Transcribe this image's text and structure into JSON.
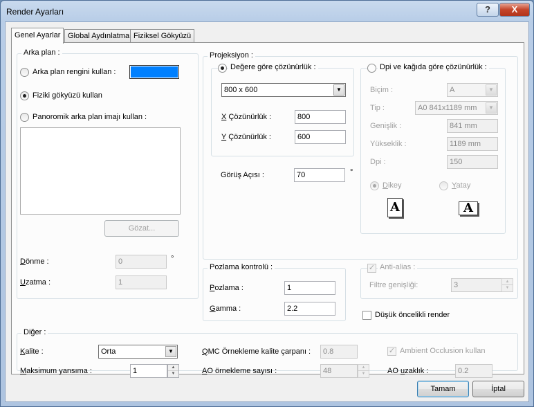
{
  "window": {
    "title": "Render Ayarları",
    "help_label": "?",
    "close_label": "X"
  },
  "tabs": [
    {
      "label": "Genel Ayarlar",
      "active": true
    },
    {
      "label": "Global Aydınlatma",
      "active": false
    },
    {
      "label": "Fiziksel Gökyüzü",
      "active": false
    }
  ],
  "background": {
    "legend": "Arka plan :",
    "color_radio_label": "Arka plan rengini kullan :",
    "color_value": "#0080ff",
    "physical_sky_label": "Fiziki gökyüzü kullan",
    "panoramic_label": "Panoromik arka plan imajı kullan :",
    "browse_label": "Gözat...",
    "rotation_label": "Dönme :",
    "rotation_value": "0",
    "rotation_unit": "°",
    "stretch_label": "Uzatma :",
    "stretch_value": "1"
  },
  "projection": {
    "legend": "Projeksiyon :",
    "by_value": {
      "legend": "Değere göre çözünürlük :",
      "resolution_select": "800 x 600",
      "x_label_prefix": "X",
      "x_label_rest": " Çözünürlük :",
      "x_value": "800",
      "y_label_prefix": "Y",
      "y_label_rest": " Çözünürlük :",
      "y_value": "600"
    },
    "fov_label": "Görüş Açısı :",
    "fov_value": "70",
    "fov_unit": "°",
    "by_dpi": {
      "legend": "Dpi ve kağıda göre çözünürlük :",
      "format_label": "Biçim :",
      "format_value": "A",
      "type_label": "Tip :",
      "type_value": "A0   841x1189 mm",
      "width_label": "Genişlik :",
      "width_value": "841 mm",
      "height_label": "Yükseklik :",
      "height_value": "1189 mm",
      "dpi_label": "Dpi :",
      "dpi_value": "150",
      "portrait_label": "Dikey",
      "landscape_label": "Yatay",
      "portrait_icon_text": "A",
      "landscape_icon_text": "A"
    }
  },
  "exposure": {
    "legend": "Pozlama kontrolü :",
    "exposure_label": "Pozlama :",
    "exposure_value": "1",
    "gamma_label": "Gamma :",
    "gamma_value": "2.2"
  },
  "antialias": {
    "label": "Anti-alias :",
    "filter_label": "Filtre genişliği:",
    "filter_value": "3"
  },
  "low_priority_label": "Düşük öncelikli render",
  "other": {
    "legend": "Diğer :",
    "quality_label": "Kalite :",
    "quality_value": "Orta",
    "max_reflection_label": "Maksimum yansıma :",
    "max_reflection_value": "1",
    "qmc_label": "QMC Örnekleme kalite çarpanı :",
    "qmc_value": "0.8",
    "ao_samples_label": "AO örnekleme sayısı :",
    "ao_samples_value": "48",
    "ambient_occlusion_label": "Ambient Occlusion kullan",
    "ao_distance_label": "AO uzaklık :",
    "ao_distance_value": "0.2"
  },
  "footer": {
    "ok_label": "Tamam",
    "cancel_label": "İptal"
  }
}
